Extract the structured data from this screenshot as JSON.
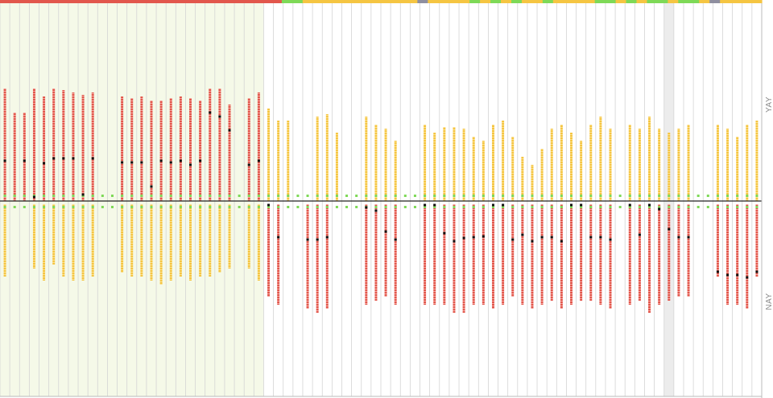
{
  "labels": {
    "yay": "YAY",
    "nay": "NAY"
  },
  "colors": {
    "red": "#e2574c",
    "yellow": "#f5c542",
    "green": "#7ed957",
    "gray": "#8f8fa0",
    "highlight": "#f5f9e8",
    "gridline": "#d4d4d4",
    "axis": "#222222",
    "dot": "#111111"
  },
  "chart_data": {
    "type": "bar",
    "title": "",
    "xlabel": "",
    "ylabel": "",
    "legend": "none",
    "grid": true,
    "ylim": [
      -135,
      145
    ],
    "highlight_range": [
      0,
      26
    ],
    "shaded_columns": [
      68
    ],
    "status_bar": [
      "red",
      "red",
      "red",
      "red",
      "red",
      "red",
      "red",
      "red",
      "red",
      "red",
      "red",
      "red",
      "red",
      "red",
      "red",
      "red",
      "red",
      "red",
      "red",
      "red",
      "red",
      "red",
      "red",
      "red",
      "red",
      "red",
      "red",
      "green",
      "green",
      "yellow",
      "yellow",
      "yellow",
      "yellow",
      "yellow",
      "yellow",
      "yellow",
      "yellow",
      "yellow",
      "yellow",
      "yellow",
      "gray",
      "yellow",
      "yellow",
      "yellow",
      "yellow",
      "green",
      "yellow",
      "green",
      "yellow",
      "green",
      "yellow",
      "yellow",
      "green",
      "yellow",
      "yellow",
      "yellow",
      "yellow",
      "green",
      "green",
      "yellow",
      "green",
      "yellow",
      "green",
      "green",
      "yellow",
      "green",
      "green",
      "yellow",
      "gray",
      "yellow",
      "yellow",
      "yellow",
      "yellow"
    ],
    "columns": [
      {
        "yay_color": "red",
        "yay": 140,
        "yay_dot": 50,
        "nay_color": "yellow",
        "nay": 90
      },
      {
        "yay_color": "red",
        "yay": 110,
        "yay_dot": null,
        "nay_color": "yellow",
        "nay": 0
      },
      {
        "yay_color": "red",
        "yay": 110,
        "yay_dot": 50,
        "nay_color": "yellow",
        "nay": 0
      },
      {
        "yay_color": "red",
        "yay": 140,
        "yay_dot": 5,
        "nay_color": "yellow",
        "nay": 80
      },
      {
        "yay_color": "red",
        "yay": 130,
        "yay_dot": 47,
        "nay_color": "yellow",
        "nay": 95
      },
      {
        "yay_color": "red",
        "yay": 140,
        "yay_dot": 53,
        "nay_color": "yellow",
        "nay": 75
      },
      {
        "yay_color": "red",
        "yay": 138,
        "yay_dot": 53,
        "nay_color": "yellow",
        "nay": 90
      },
      {
        "yay_color": "red",
        "yay": 135,
        "yay_dot": 53,
        "nay_color": "yellow",
        "nay": 95
      },
      {
        "yay_color": "red",
        "yay": 132,
        "yay_dot": 8,
        "nay_color": "yellow",
        "nay": 95
      },
      {
        "yay_color": "red",
        "yay": 135,
        "yay_dot": 53,
        "nay_color": "yellow",
        "nay": 90
      },
      {
        "yay_color": "red",
        "yay": 0,
        "yay_dot": null,
        "nay_color": "yellow",
        "nay": 0
      },
      {
        "yay_color": "red",
        "yay": 0,
        "yay_dot": null,
        "nay_color": "yellow",
        "nay": 0
      },
      {
        "yay_color": "red",
        "yay": 130,
        "yay_dot": 48,
        "nay_color": "yellow",
        "nay": 85
      },
      {
        "yay_color": "red",
        "yay": 128,
        "yay_dot": 48,
        "nay_color": "yellow",
        "nay": 90
      },
      {
        "yay_color": "red",
        "yay": 130,
        "yay_dot": 48,
        "nay_color": "yellow",
        "nay": 90
      },
      {
        "yay_color": "red",
        "yay": 125,
        "yay_dot": 18,
        "nay_color": "yellow",
        "nay": 95
      },
      {
        "yay_color": "red",
        "yay": 125,
        "yay_dot": 50,
        "nay_color": "yellow",
        "nay": 100
      },
      {
        "yay_color": "red",
        "yay": 128,
        "yay_dot": 48,
        "nay_color": "yellow",
        "nay": 95
      },
      {
        "yay_color": "red",
        "yay": 130,
        "yay_dot": 50,
        "nay_color": "yellow",
        "nay": 90
      },
      {
        "yay_color": "red",
        "yay": 128,
        "yay_dot": 45,
        "nay_color": "yellow",
        "nay": 95
      },
      {
        "yay_color": "red",
        "yay": 125,
        "yay_dot": 50,
        "nay_color": "yellow",
        "nay": 90
      },
      {
        "yay_color": "red",
        "yay": 140,
        "yay_dot": 110,
        "nay_color": "yellow",
        "nay": 90
      },
      {
        "yay_color": "red",
        "yay": 140,
        "yay_dot": 105,
        "nay_color": "yellow",
        "nay": 85
      },
      {
        "yay_color": "red",
        "yay": 120,
        "yay_dot": 88,
        "nay_color": "yellow",
        "nay": 80
      },
      {
        "yay_color": "red",
        "yay": 0,
        "yay_dot": null,
        "nay_color": "yellow",
        "nay": 0
      },
      {
        "yay_color": "red",
        "yay": 128,
        "yay_dot": 45,
        "nay_color": "yellow",
        "nay": 80
      },
      {
        "yay_color": "red",
        "yay": 135,
        "yay_dot": 50,
        "nay_color": "yellow",
        "nay": 95
      },
      {
        "yay_color": "yellow",
        "yay": 115,
        "yay_dot": null,
        "nay_color": "red",
        "nay": 115,
        "nay_dot": 5
      },
      {
        "yay_color": "yellow",
        "yay": 100,
        "yay_dot": null,
        "nay_color": "red",
        "nay": 125,
        "nay_dot": 45
      },
      {
        "yay_color": "yellow",
        "yay": 100,
        "yay_dot": null,
        "nay_color": "red",
        "nay": 0
      },
      {
        "yay_color": "yellow",
        "yay": 0,
        "yay_dot": null,
        "nay_color": "red",
        "nay": 0
      },
      {
        "yay_color": "yellow",
        "yay": 0,
        "yay_dot": null,
        "nay_color": "red",
        "nay": 130,
        "nay_dot": 48
      },
      {
        "yay_color": "yellow",
        "yay": 105,
        "yay_dot": null,
        "nay_color": "red",
        "nay": 135,
        "nay_dot": 48
      },
      {
        "yay_color": "yellow",
        "yay": 108,
        "yay_dot": null,
        "nay_color": "red",
        "nay": 130,
        "nay_dot": 45
      },
      {
        "yay_color": "yellow",
        "yay": 85,
        "yay_dot": null,
        "nay_color": "red",
        "nay": 0
      },
      {
        "yay_color": "yellow",
        "yay": 0,
        "yay_dot": null,
        "nay_color": "red",
        "nay": 0
      },
      {
        "yay_color": "yellow",
        "yay": 0,
        "yay_dot": null,
        "nay_color": "red",
        "nay": 0
      },
      {
        "yay_color": "yellow",
        "yay": 105,
        "yay_dot": null,
        "nay_color": "red",
        "nay": 125,
        "nay_dot": 8
      },
      {
        "yay_color": "yellow",
        "yay": 95,
        "yay_dot": null,
        "nay_color": "red",
        "nay": 120,
        "nay_dot": 12
      },
      {
        "yay_color": "yellow",
        "yay": 90,
        "yay_dot": null,
        "nay_color": "red",
        "nay": 115,
        "nay_dot": 38
      },
      {
        "yay_color": "yellow",
        "yay": 75,
        "yay_dot": null,
        "nay_color": "red",
        "nay": 125,
        "nay_dot": 48
      },
      {
        "yay_color": "yellow",
        "yay": 0,
        "yay_dot": null,
        "nay_color": "red",
        "nay": 0
      },
      {
        "yay_color": "yellow",
        "yay": 0,
        "yay_dot": null,
        "nay_color": "red",
        "nay": 0
      },
      {
        "yay_color": "yellow",
        "yay": 95,
        "yay_dot": null,
        "nay_color": "red",
        "nay": 125,
        "nay_dot": 5
      },
      {
        "yay_color": "yellow",
        "yay": 85,
        "yay_dot": null,
        "nay_color": "red",
        "nay": 125,
        "nay_dot": 5
      },
      {
        "yay_color": "yellow",
        "yay": 92,
        "yay_dot": null,
        "nay_color": "red",
        "nay": 125,
        "nay_dot": 40
      },
      {
        "yay_color": "yellow",
        "yay": 92,
        "yay_dot": null,
        "nay_color": "red",
        "nay": 135,
        "nay_dot": 50
      },
      {
        "yay_color": "yellow",
        "yay": 90,
        "yay_dot": null,
        "nay_color": "red",
        "nay": 135,
        "nay_dot": 46
      },
      {
        "yay_color": "yellow",
        "yay": 80,
        "yay_dot": null,
        "nay_color": "red",
        "nay": 125,
        "nay_dot": 45
      },
      {
        "yay_color": "yellow",
        "yay": 75,
        "yay_dot": null,
        "nay_color": "red",
        "nay": 125,
        "nay_dot": 44
      },
      {
        "yay_color": "yellow",
        "yay": 95,
        "yay_dot": null,
        "nay_color": "red",
        "nay": 130,
        "nay_dot": 5
      },
      {
        "yay_color": "yellow",
        "yay": 100,
        "yay_dot": null,
        "nay_color": "red",
        "nay": 125,
        "nay_dot": 5
      },
      {
        "yay_color": "yellow",
        "yay": 80,
        "yay_dot": null,
        "nay_color": "red",
        "nay": 115,
        "nay_dot": 48
      },
      {
        "yay_color": "yellow",
        "yay": 55,
        "yay_dot": null,
        "nay_color": "red",
        "nay": 125,
        "nay_dot": 42
      },
      {
        "yay_color": "yellow",
        "yay": 45,
        "yay_dot": null,
        "nay_color": "red",
        "nay": 130,
        "nay_dot": 50
      },
      {
        "yay_color": "yellow",
        "yay": 65,
        "yay_dot": null,
        "nay_color": "red",
        "nay": 125,
        "nay_dot": 45
      },
      {
        "yay_color": "yellow",
        "yay": 90,
        "yay_dot": null,
        "nay_color": "red",
        "nay": 120,
        "nay_dot": 45
      },
      {
        "yay_color": "yellow",
        "yay": 95,
        "yay_dot": null,
        "nay_color": "red",
        "nay": 130,
        "nay_dot": 50
      },
      {
        "yay_color": "yellow",
        "yay": 85,
        "yay_dot": null,
        "nay_color": "red",
        "nay": 125,
        "nay_dot": 5
      },
      {
        "yay_color": "yellow",
        "yay": 75,
        "yay_dot": null,
        "nay_color": "red",
        "nay": 120,
        "nay_dot": 5
      },
      {
        "yay_color": "yellow",
        "yay": 95,
        "yay_dot": null,
        "nay_color": "red",
        "nay": 120,
        "nay_dot": 45
      },
      {
        "yay_color": "yellow",
        "yay": 105,
        "yay_dot": null,
        "nay_color": "red",
        "nay": 125,
        "nay_dot": 45
      },
      {
        "yay_color": "yellow",
        "yay": 90,
        "yay_dot": null,
        "nay_color": "red",
        "nay": 130,
        "nay_dot": 48
      },
      {
        "yay_color": "yellow",
        "yay": 0,
        "yay_dot": null,
        "nay_color": "red",
        "nay": 0
      },
      {
        "yay_color": "yellow",
        "yay": 95,
        "yay_dot": null,
        "nay_color": "red",
        "nay": 125,
        "nay_dot": 5
      },
      {
        "yay_color": "yellow",
        "yay": 90,
        "yay_dot": null,
        "nay_color": "red",
        "nay": 120,
        "nay_dot": 42
      },
      {
        "yay_color": "yellow",
        "yay": 105,
        "yay_dot": null,
        "nay_color": "red",
        "nay": 135,
        "nay_dot": 5
      },
      {
        "yay_color": "yellow",
        "yay": 90,
        "yay_dot": null,
        "nay_color": "red",
        "nay": 125,
        "nay_dot": 10
      },
      {
        "yay_color": "yellow",
        "yay": 85,
        "yay_dot": null,
        "nay_color": "red",
        "nay": 120,
        "nay_dot": 35
      },
      {
        "yay_color": "yellow",
        "yay": 90,
        "yay_dot": null,
        "nay_color": "red",
        "nay": 115,
        "nay_dot": 45
      },
      {
        "yay_color": "yellow",
        "yay": 95,
        "yay_dot": null,
        "nay_color": "red",
        "nay": 115,
        "nay_dot": 45
      },
      {
        "yay_color": "yellow",
        "yay": 0,
        "yay_dot": null,
        "nay_color": "red",
        "nay": 0
      },
      {
        "yay_color": "yellow",
        "yay": 0,
        "yay_dot": null,
        "nay_color": "red",
        "nay": 0
      },
      {
        "yay_color": "yellow",
        "yay": 95,
        "yay_dot": null,
        "nay_color": "red",
        "nay": 90,
        "nay_dot": 88
      },
      {
        "yay_color": "yellow",
        "yay": 90,
        "yay_dot": null,
        "nay_color": "red",
        "nay": 125,
        "nay_dot": 92
      },
      {
        "yay_color": "yellow",
        "yay": 80,
        "yay_dot": null,
        "nay_color": "red",
        "nay": 125,
        "nay_dot": 92
      },
      {
        "yay_color": "yellow",
        "yay": 95,
        "yay_dot": null,
        "nay_color": "red",
        "nay": 130,
        "nay_dot": 95
      },
      {
        "yay_color": "yellow",
        "yay": 100,
        "yay_dot": null,
        "nay_color": "red",
        "nay": 90,
        "nay_dot": 88
      }
    ]
  }
}
